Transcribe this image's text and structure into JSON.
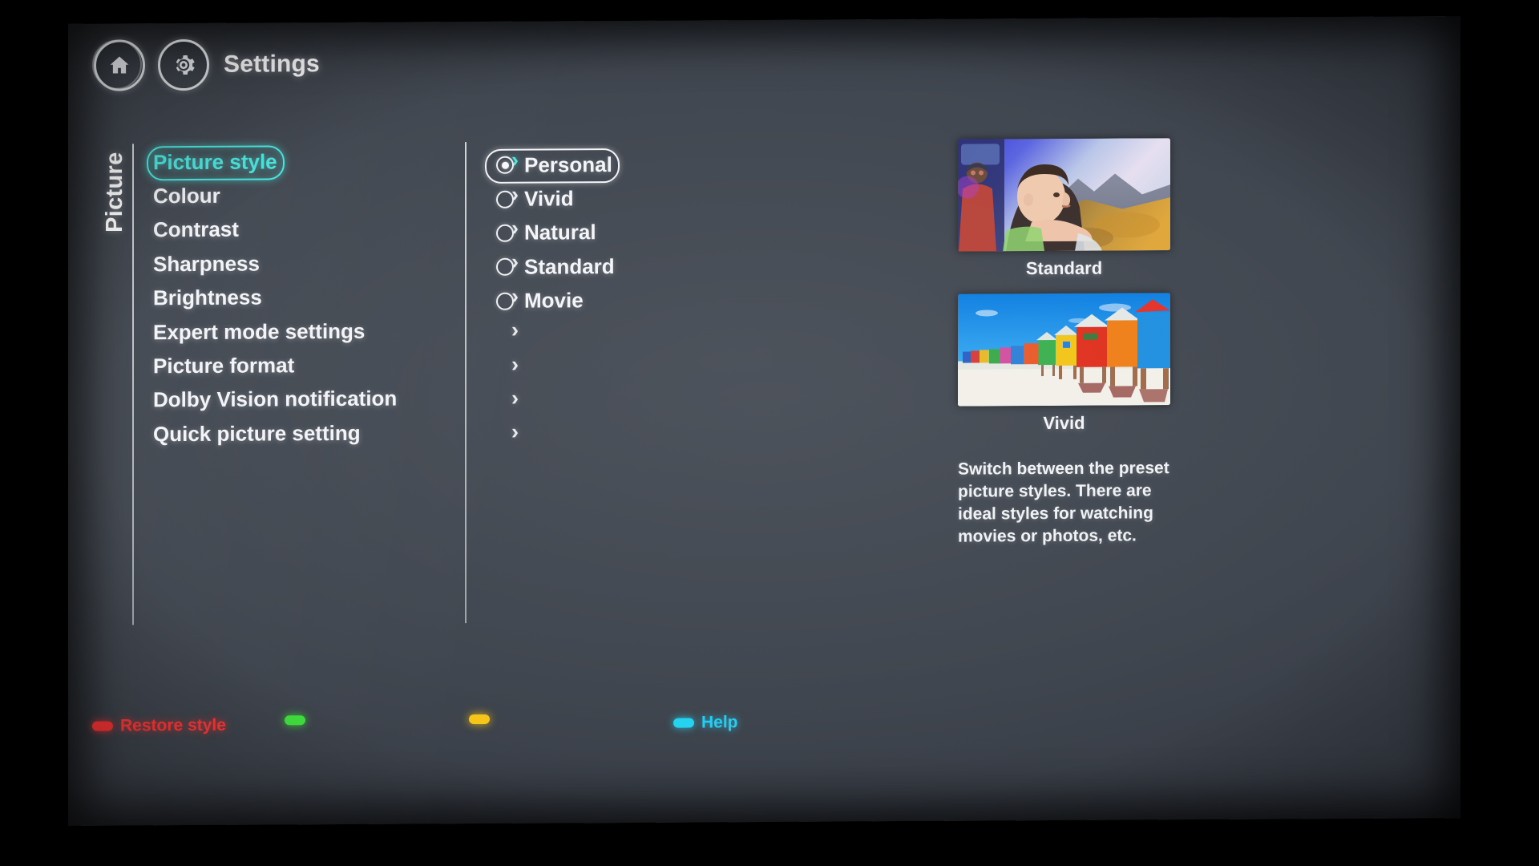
{
  "header": {
    "home_icon": "home-icon",
    "settings_icon": "gear-icon",
    "title": "Settings"
  },
  "category": {
    "label": "Picture"
  },
  "menu": {
    "items": [
      {
        "label": "Picture style",
        "selected": true,
        "chevron": "chevron-right-icon"
      },
      {
        "label": "Colour",
        "selected": false,
        "chevron": "chevron-right-icon"
      },
      {
        "label": "Contrast",
        "selected": false,
        "chevron": "chevron-right-icon"
      },
      {
        "label": "Sharpness",
        "selected": false,
        "chevron": "chevron-right-icon"
      },
      {
        "label": "Brightness",
        "selected": false,
        "chevron": "chevron-right-icon"
      },
      {
        "label": "Expert mode settings",
        "selected": false,
        "chevron": "chevron-right-icon"
      },
      {
        "label": "Picture format",
        "selected": false,
        "chevron": "chevron-right-icon"
      },
      {
        "label": "Dolby Vision notification",
        "selected": false,
        "chevron": "chevron-right-icon"
      },
      {
        "label": "Quick picture setting",
        "selected": false,
        "chevron": "chevron-right-icon"
      }
    ]
  },
  "options": {
    "items": [
      {
        "label": "Personal",
        "checked": true,
        "focused": true
      },
      {
        "label": "Vivid",
        "checked": false,
        "focused": false
      },
      {
        "label": "Natural",
        "checked": false,
        "focused": false
      },
      {
        "label": "Standard",
        "checked": false,
        "focused": false
      },
      {
        "label": "Movie",
        "checked": false,
        "focused": false
      }
    ]
  },
  "preview": {
    "thumbnails": [
      {
        "caption": "Standard",
        "image": "girl-looking-at-landscape-photo"
      },
      {
        "caption": "Vivid",
        "image": "colourful-beach-huts-photo"
      }
    ],
    "description": "Switch between the preset picture styles. There are ideal styles for watching movies or photos, etc."
  },
  "footer": {
    "keys": [
      {
        "label": "Restore style",
        "colour": "#fb3333",
        "name": "red"
      },
      {
        "label": "",
        "colour": "#3ee03c",
        "name": "green"
      },
      {
        "label": "",
        "colour": "#f5c518",
        "name": "yellow"
      },
      {
        "label": "Help",
        "colour": "#24cdf2",
        "name": "cyan"
      }
    ]
  },
  "theme": {
    "accent": "#49e8e0",
    "panel_bg": "#3f454e",
    "text": "#f2f4f7"
  }
}
